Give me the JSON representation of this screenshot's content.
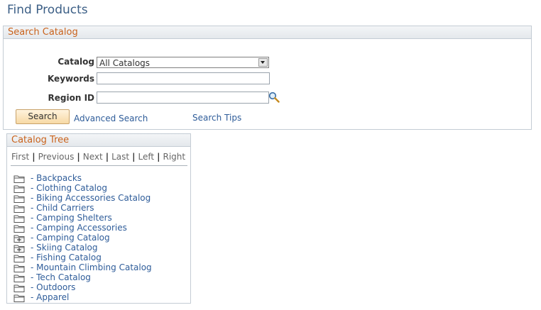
{
  "page": {
    "title": "Find Products"
  },
  "search_catalog": {
    "header": "Search Catalog",
    "catalog_label": "Catalog",
    "catalog_value": "All Catalogs",
    "keywords_label": "Keywords",
    "keywords_value": "",
    "region_label": "Region ID",
    "region_value": "",
    "search_button": "Search",
    "advanced_search": "Advanced Search",
    "search_tips": "Search Tips"
  },
  "catalog_tree": {
    "header": "Catalog Tree",
    "nav": {
      "first": "First",
      "previous": "Previous",
      "next": "Next",
      "last": "Last",
      "left": "Left",
      "right": "Right",
      "separator": "|"
    },
    "items": [
      {
        "label": "- Backpacks",
        "expandable": false
      },
      {
        "label": "- Clothing Catalog",
        "expandable": false
      },
      {
        "label": "- Biking Accessories Catalog",
        "expandable": false
      },
      {
        "label": "- Child Carriers",
        "expandable": false
      },
      {
        "label": "- Camping Shelters",
        "expandable": false
      },
      {
        "label": "- Camping Accessories",
        "expandable": false
      },
      {
        "label": "- Camping Catalog",
        "expandable": true
      },
      {
        "label": "- Skiing Catalog",
        "expandable": true
      },
      {
        "label": "- Fishing Catalog",
        "expandable": false
      },
      {
        "label": "- Mountain Climbing Catalog",
        "expandable": false
      },
      {
        "label": "- Tech Catalog",
        "expandable": false
      },
      {
        "label": "- Outdoors",
        "expandable": false
      },
      {
        "label": "- Apparel",
        "expandable": false
      }
    ]
  },
  "colors": {
    "title": "#3c5f86",
    "header_text": "#c9621b",
    "link": "#2e5c99",
    "button_fill": "#f7d9a5",
    "folder": "#555555"
  },
  "icons": {
    "lookup": "magnifier-lookup-icon",
    "folder": "folder-icon",
    "folder_expand": "folder-plus-icon",
    "dropdown": "chevron-down-icon"
  }
}
